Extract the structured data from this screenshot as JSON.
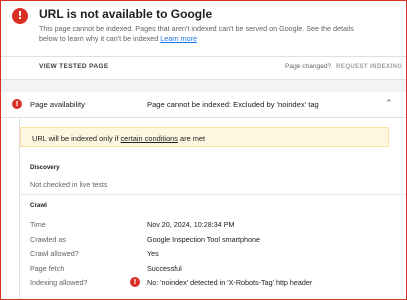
{
  "header": {
    "title": "URL is not available to Google",
    "desc_line1": "This page cannot be indexed. Pages that aren't indexed can't be served on Google. See",
    "desc_line2_prefix": "the details below to learn why it can't be indexed ",
    "learn_more": "Learn more"
  },
  "actions": {
    "view_tested": "VIEW TESTED PAGE",
    "page_changed": "Page changed?",
    "request_indexing": "REQUEST INDEXING"
  },
  "availability": {
    "label": "Page availability",
    "value": "Page cannot be indexed: Excluded by 'noindex' tag"
  },
  "notice": {
    "prefix": "URL will be indexed only if ",
    "link": "certain conditions",
    "suffix": " are met"
  },
  "discovery": {
    "heading": "Discovery",
    "text": "Not checked in live tests"
  },
  "crawl": {
    "heading": "Crawl",
    "rows": [
      {
        "label": "Time",
        "value": "Nov 20, 2024, 10:28:34 PM"
      },
      {
        "label": "Crawled as",
        "value": "Google Inspection Tool smartphone"
      },
      {
        "label": "Crawl allowed?",
        "value": "Yes"
      },
      {
        "label": "Page fetch",
        "value": "Successful"
      },
      {
        "label": "Indexing allowed?",
        "value": "No: 'noindex' detected in 'X-Robots-Tag' http header"
      }
    ]
  },
  "colors": {
    "error": "#d93025",
    "notice_bg": "#fef7e0",
    "link": "#1a73e8"
  },
  "icons": {
    "error": "error-icon",
    "expand": "chevron-up-icon"
  }
}
